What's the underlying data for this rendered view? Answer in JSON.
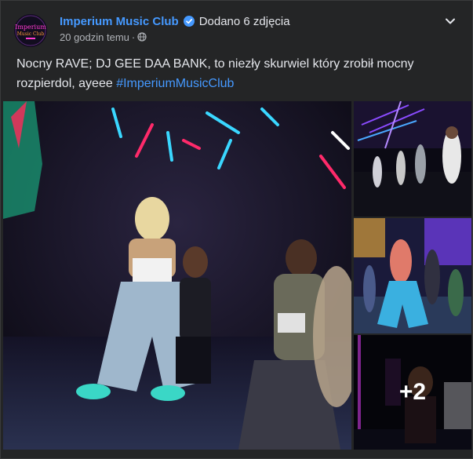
{
  "post": {
    "page_name": "Imperium Music Club",
    "action": "Dodano 6 zdjęcia",
    "time": "20 godzin temu",
    "separator": "·",
    "text": "Nocny RAVE; DJ GEE DAA BANK, to niezły skurwiel który zrobił mocny rozpierdol, ayeee ",
    "hashtag": "#ImperiumMusicClub",
    "more_photos_label": "+2"
  },
  "avatar_logo": {
    "line1": "Imperium",
    "line2": "Music Club"
  },
  "colors": {
    "card_bg": "#242526",
    "link": "#4599ff",
    "text": "#e4e6eb",
    "meta": "#b0b3b8"
  },
  "icons": {
    "verified": "verified-badge-icon",
    "privacy": "globe-icon",
    "menu": "chevron-down-icon"
  }
}
